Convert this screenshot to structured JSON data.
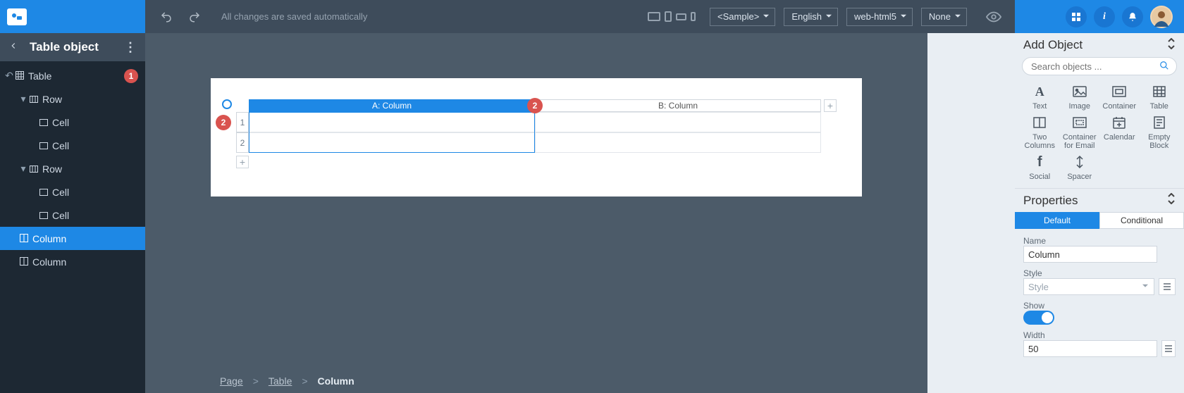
{
  "topbar": {
    "autosave_msg": "All changes are saved automatically",
    "sample_dropdown": "<Sample>",
    "language_dropdown": "English",
    "tech_dropdown": "web-html5",
    "none_dropdown": "None"
  },
  "sidebar": {
    "title": "Table object",
    "tree": {
      "table": {
        "label": "Table",
        "badge": "1"
      },
      "row1": {
        "label": "Row"
      },
      "cell1": {
        "label": "Cell"
      },
      "cell2": {
        "label": "Cell"
      },
      "row2": {
        "label": "Row"
      },
      "cell3": {
        "label": "Cell"
      },
      "cell4": {
        "label": "Cell"
      },
      "col1": {
        "label": "Column"
      },
      "col2": {
        "label": "Column"
      }
    }
  },
  "canvas": {
    "colA": {
      "label": "A:  Column",
      "badge": "2"
    },
    "colB": {
      "label": "B:  Column"
    },
    "row1_label": "1",
    "row1_badge": "2",
    "row2_label": "2"
  },
  "breadcrumb": {
    "page": "Page",
    "table": "Table",
    "column": "Column",
    "sep": ">"
  },
  "addObject": {
    "title": "Add Object",
    "search_placeholder": "Search objects ...",
    "items": {
      "text": "Text",
      "image": "Image",
      "container": "Container",
      "table": "Table",
      "two_cols": "Two Columns",
      "container_email": "Container for Email",
      "calendar": "Calendar",
      "empty_block": "Empty Block",
      "social": "Social",
      "spacer": "Spacer"
    }
  },
  "properties": {
    "title": "Properties",
    "tab_default": "Default",
    "tab_conditional": "Conditional",
    "name_label": "Name",
    "name_value": "Column",
    "style_label": "Style",
    "style_placeholder": "Style",
    "show_label": "Show",
    "width_label": "Width",
    "width_value": "50"
  }
}
